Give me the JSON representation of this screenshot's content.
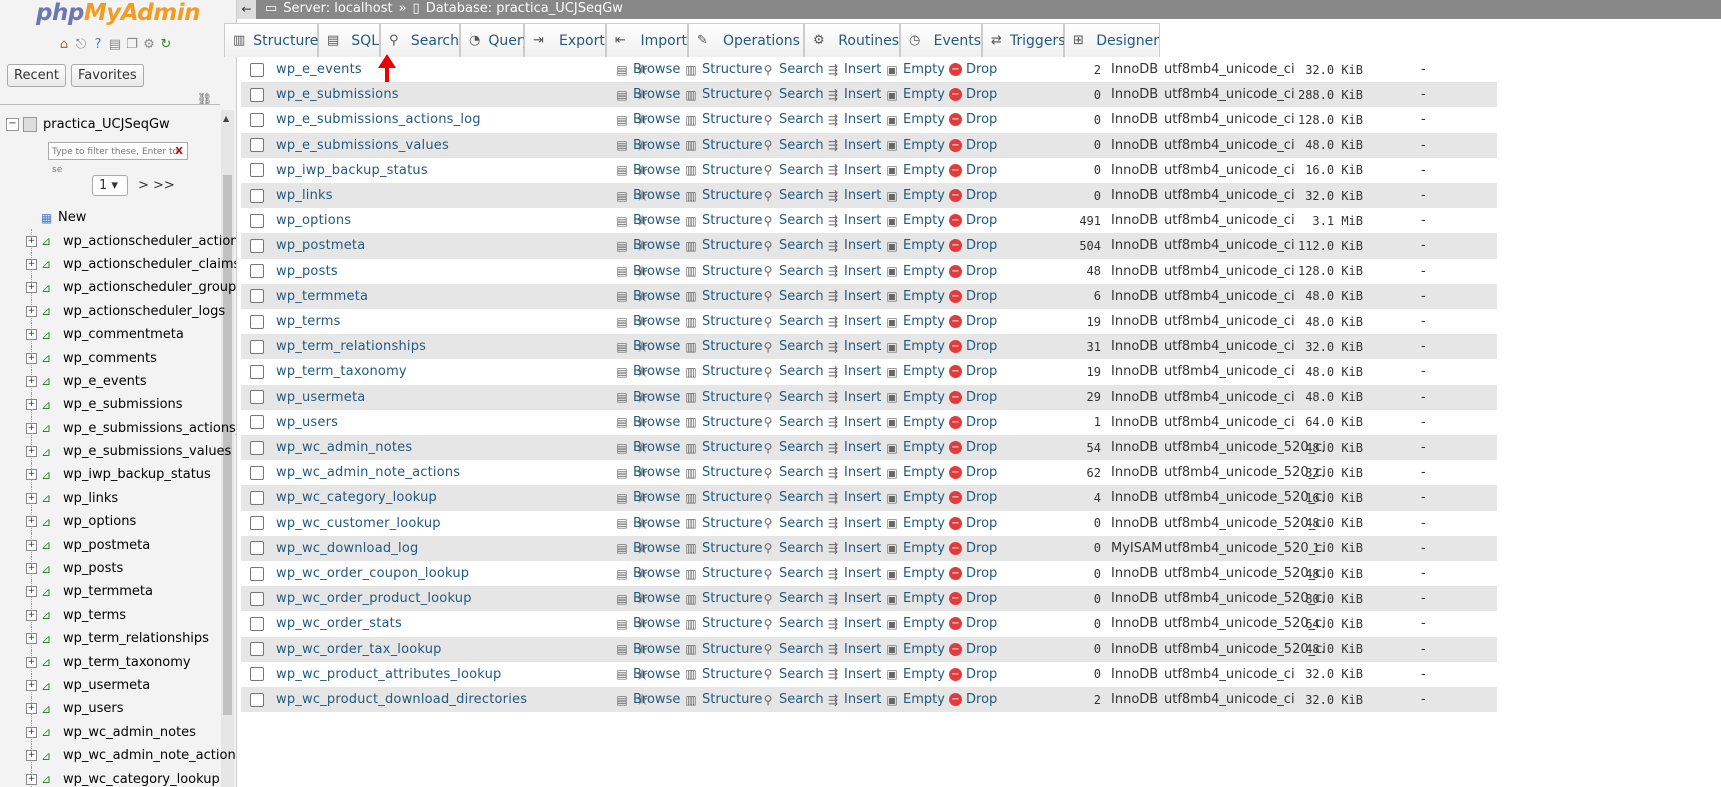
{
  "nav": {
    "logo_php": "php",
    "logo_myadmin": "MyAdmin",
    "recent_label": "Recent",
    "favorites_label": "Favorites",
    "database_name": "practica_UCJSeqGw",
    "filter_placeholder": "Type to filter these, Enter to se",
    "filter_clear": "X",
    "page_select": "1",
    "page_next": "> >>",
    "new_label": "New",
    "tables": [
      "wp_actionscheduler_actions",
      "wp_actionscheduler_claims",
      "wp_actionscheduler_groups",
      "wp_actionscheduler_logs",
      "wp_commentmeta",
      "wp_comments",
      "wp_e_events",
      "wp_e_submissions",
      "wp_e_submissions_actions_log",
      "wp_e_submissions_values",
      "wp_iwp_backup_status",
      "wp_links",
      "wp_options",
      "wp_postmeta",
      "wp_posts",
      "wp_termmeta",
      "wp_terms",
      "wp_term_relationships",
      "wp_term_taxonomy",
      "wp_usermeta",
      "wp_users",
      "wp_wc_admin_notes",
      "wp_wc_admin_note_actions",
      "wp_wc_category_lookup"
    ]
  },
  "header": {
    "server_label": "Server: localhost",
    "separator": "»",
    "database_label": "Database: practica_UCJSeqGw"
  },
  "tabs": [
    {
      "label": "Structure",
      "icon": "structure-icon"
    },
    {
      "label": "SQL",
      "icon": "sql-icon"
    },
    {
      "label": "Search",
      "icon": "search-icon"
    },
    {
      "label": "Query",
      "icon": "query-icon"
    },
    {
      "label": "Export",
      "icon": "export-icon"
    },
    {
      "label": "Import",
      "icon": "import-icon"
    },
    {
      "label": "Operations",
      "icon": "wrench-icon"
    },
    {
      "label": "Routines",
      "icon": "routines-icon"
    },
    {
      "label": "Events",
      "icon": "clock-icon"
    },
    {
      "label": "Triggers",
      "icon": "triggers-icon"
    },
    {
      "label": "Designer",
      "icon": "designer-icon"
    }
  ],
  "actions": {
    "browse": "Browse",
    "structure": "Structure",
    "search": "Search",
    "insert": "Insert",
    "empty": "Empty",
    "drop": "Drop"
  },
  "rows": [
    {
      "name": "wp_e_events",
      "rows": "2",
      "engine": "InnoDB",
      "collation": "utf8mb4_unicode_ci",
      "size": "32.0 KiB",
      "overhead": "-"
    },
    {
      "name": "wp_e_submissions",
      "rows": "0",
      "engine": "InnoDB",
      "collation": "utf8mb4_unicode_ci",
      "size": "288.0 KiB",
      "overhead": "-"
    },
    {
      "name": "wp_e_submissions_actions_log",
      "rows": "0",
      "engine": "InnoDB",
      "collation": "utf8mb4_unicode_ci",
      "size": "128.0 KiB",
      "overhead": "-"
    },
    {
      "name": "wp_e_submissions_values",
      "rows": "0",
      "engine": "InnoDB",
      "collation": "utf8mb4_unicode_ci",
      "size": "48.0 KiB",
      "overhead": "-"
    },
    {
      "name": "wp_iwp_backup_status",
      "rows": "0",
      "engine": "InnoDB",
      "collation": "utf8mb4_unicode_ci",
      "size": "16.0 KiB",
      "overhead": "-"
    },
    {
      "name": "wp_links",
      "rows": "0",
      "engine": "InnoDB",
      "collation": "utf8mb4_unicode_ci",
      "size": "32.0 KiB",
      "overhead": "-"
    },
    {
      "name": "wp_options",
      "rows": "491",
      "engine": "InnoDB",
      "collation": "utf8mb4_unicode_ci",
      "size": "3.1 MiB",
      "overhead": "-"
    },
    {
      "name": "wp_postmeta",
      "rows": "504",
      "engine": "InnoDB",
      "collation": "utf8mb4_unicode_ci",
      "size": "112.0 KiB",
      "overhead": "-"
    },
    {
      "name": "wp_posts",
      "rows": "48",
      "engine": "InnoDB",
      "collation": "utf8mb4_unicode_ci",
      "size": "128.0 KiB",
      "overhead": "-"
    },
    {
      "name": "wp_termmeta",
      "rows": "6",
      "engine": "InnoDB",
      "collation": "utf8mb4_unicode_ci",
      "size": "48.0 KiB",
      "overhead": "-"
    },
    {
      "name": "wp_terms",
      "rows": "19",
      "engine": "InnoDB",
      "collation": "utf8mb4_unicode_ci",
      "size": "48.0 KiB",
      "overhead": "-"
    },
    {
      "name": "wp_term_relationships",
      "rows": "31",
      "engine": "InnoDB",
      "collation": "utf8mb4_unicode_ci",
      "size": "32.0 KiB",
      "overhead": "-"
    },
    {
      "name": "wp_term_taxonomy",
      "rows": "19",
      "engine": "InnoDB",
      "collation": "utf8mb4_unicode_ci",
      "size": "48.0 KiB",
      "overhead": "-"
    },
    {
      "name": "wp_usermeta",
      "rows": "29",
      "engine": "InnoDB",
      "collation": "utf8mb4_unicode_ci",
      "size": "48.0 KiB",
      "overhead": "-"
    },
    {
      "name": "wp_users",
      "rows": "1",
      "engine": "InnoDB",
      "collation": "utf8mb4_unicode_ci",
      "size": "64.0 KiB",
      "overhead": "-"
    },
    {
      "name": "wp_wc_admin_notes",
      "rows": "54",
      "engine": "InnoDB",
      "collation": "utf8mb4_unicode_520_ci",
      "size": "48.0 KiB",
      "overhead": "-"
    },
    {
      "name": "wp_wc_admin_note_actions",
      "rows": "62",
      "engine": "InnoDB",
      "collation": "utf8mb4_unicode_520_ci",
      "size": "32.0 KiB",
      "overhead": "-"
    },
    {
      "name": "wp_wc_category_lookup",
      "rows": "4",
      "engine": "InnoDB",
      "collation": "utf8mb4_unicode_520_ci",
      "size": "16.0 KiB",
      "overhead": "-"
    },
    {
      "name": "wp_wc_customer_lookup",
      "rows": "0",
      "engine": "InnoDB",
      "collation": "utf8mb4_unicode_520_ci",
      "size": "48.0 KiB",
      "overhead": "-"
    },
    {
      "name": "wp_wc_download_log",
      "rows": "0",
      "engine": "MyISAM",
      "collation": "utf8mb4_unicode_520_ci",
      "size": "1.0 KiB",
      "overhead": "-"
    },
    {
      "name": "wp_wc_order_coupon_lookup",
      "rows": "0",
      "engine": "InnoDB",
      "collation": "utf8mb4_unicode_520_ci",
      "size": "48.0 KiB",
      "overhead": "-"
    },
    {
      "name": "wp_wc_order_product_lookup",
      "rows": "0",
      "engine": "InnoDB",
      "collation": "utf8mb4_unicode_520_ci",
      "size": "80.0 KiB",
      "overhead": "-"
    },
    {
      "name": "wp_wc_order_stats",
      "rows": "0",
      "engine": "InnoDB",
      "collation": "utf8mb4_unicode_520_ci",
      "size": "64.0 KiB",
      "overhead": "-"
    },
    {
      "name": "wp_wc_order_tax_lookup",
      "rows": "0",
      "engine": "InnoDB",
      "collation": "utf8mb4_unicode_520_ci",
      "size": "48.0 KiB",
      "overhead": "-"
    },
    {
      "name": "wp_wc_product_attributes_lookup",
      "rows": "0",
      "engine": "InnoDB",
      "collation": "utf8mb4_unicode_ci",
      "size": "32.0 KiB",
      "overhead": "-"
    },
    {
      "name": "wp_wc_product_download_directories",
      "rows": "2",
      "engine": "InnoDB",
      "collation": "utf8mb4_unicode_ci",
      "size": "32.0 KiB",
      "overhead": "-"
    }
  ]
}
